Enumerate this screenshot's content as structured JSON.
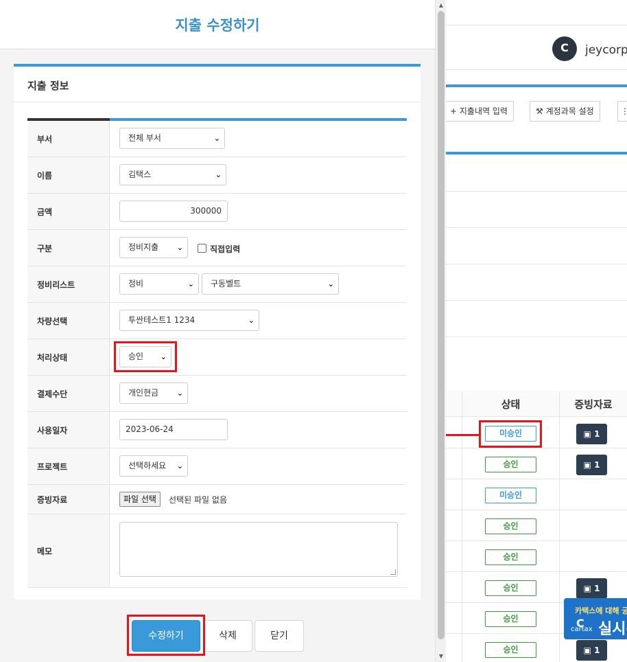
{
  "background": {
    "user_name": "jeycorp님",
    "logo_text": "C",
    "toolbar": {
      "add_expense_label": "+ 지출내역 입력",
      "account_settings_label": "계정과목 설정"
    },
    "table": {
      "headers": {
        "status": "상태",
        "evidence": "증빙자료"
      },
      "rows": [
        {
          "status": "미승인",
          "status_color": "blue",
          "evidence": "1"
        },
        {
          "status": "승인",
          "status_color": "green",
          "evidence": "1"
        },
        {
          "status": "미승인",
          "status_color": "blue",
          "evidence": ""
        },
        {
          "status": "승인",
          "status_color": "green",
          "evidence": ""
        },
        {
          "status": "승인",
          "status_color": "green",
          "evidence": ""
        },
        {
          "status": "승인",
          "status_color": "green",
          "evidence": "1"
        },
        {
          "status": "승인",
          "status_color": "green",
          "evidence": ""
        },
        {
          "status": "승인",
          "status_color": "green",
          "evidence": "1"
        }
      ]
    },
    "ad": {
      "top_text": "카택스에 대해 궁",
      "brand": "cartax",
      "big_text": "실시간"
    }
  },
  "modal": {
    "title": "지출 수정하기",
    "panel_title": "지출 정보",
    "fields": {
      "department": {
        "label": "부서",
        "value": "전체 부서"
      },
      "name": {
        "label": "이름",
        "value": "김택스"
      },
      "amount": {
        "label": "금액",
        "value": "300000"
      },
      "category": {
        "label": "구분",
        "value": "정비지출",
        "direct_input_label": "직접입력"
      },
      "maintenance": {
        "label": "정비리스트",
        "value1": "정비",
        "value2": "구동벨트"
      },
      "vehicle": {
        "label": "차량선택",
        "value": "투싼테스트1 1234"
      },
      "status": {
        "label": "처리상태",
        "value": "승인"
      },
      "payment": {
        "label": "결제수단",
        "value": "개인현금"
      },
      "date": {
        "label": "사용일자",
        "value": "2023-06-24"
      },
      "project": {
        "label": "프로젝트",
        "value": "선택하세요"
      },
      "evidence": {
        "label": "증빙자료",
        "file_button": "파일 선택",
        "file_status": "선택된 파일 없음"
      },
      "memo": {
        "label": "메모",
        "value": ""
      }
    },
    "buttons": {
      "save": "수정하기",
      "delete": "삭제",
      "close": "닫기"
    }
  },
  "colors": {
    "accent": "#3a9ad9",
    "title_blue": "#3a8fd0",
    "highlight_red": "#e8141c",
    "approved_green": "#3c9a3c",
    "dark_button": "#2c3e50"
  }
}
